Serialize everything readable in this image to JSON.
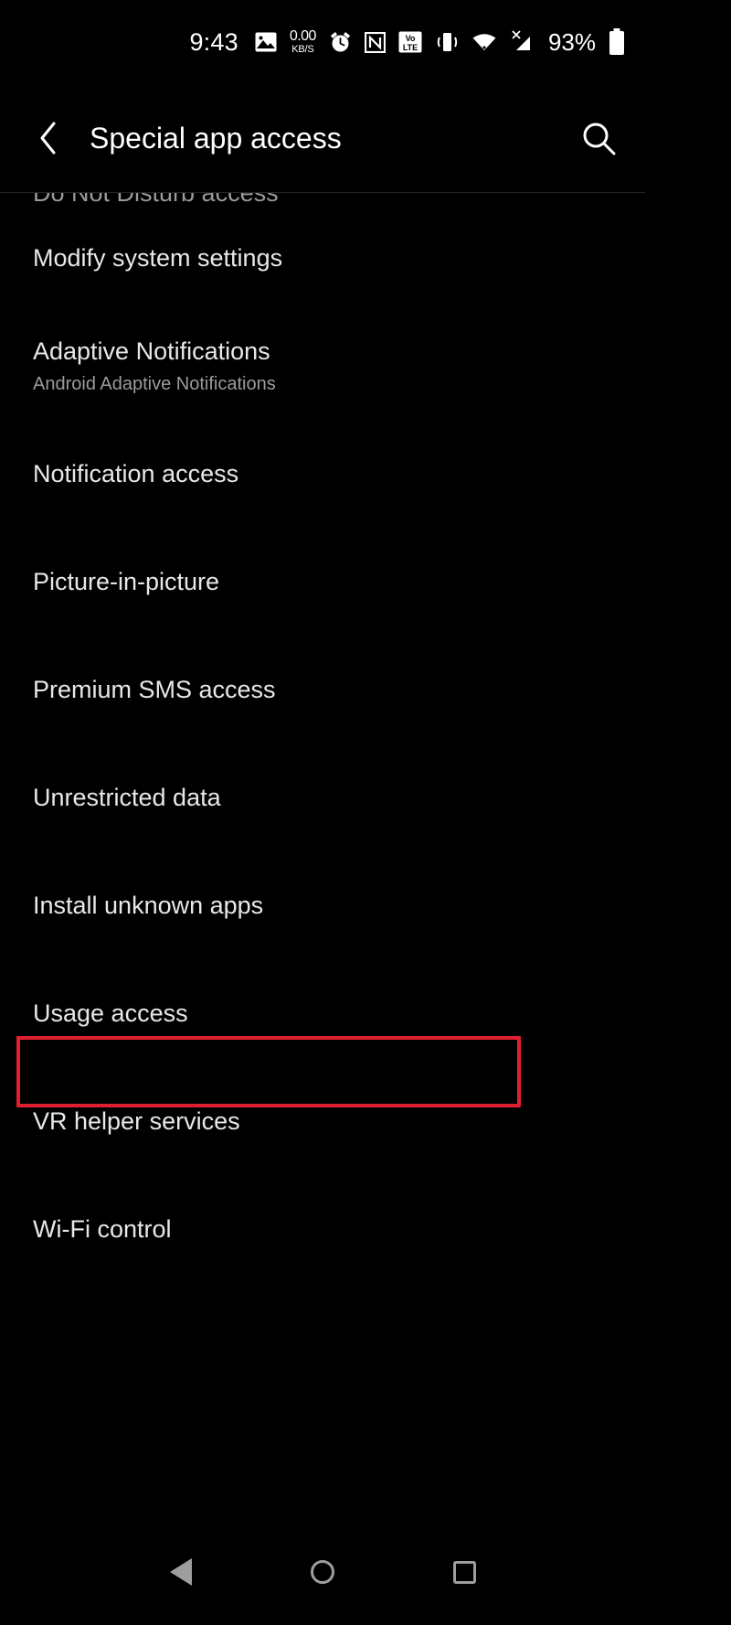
{
  "status_bar": {
    "clock": "9:43",
    "net_speed_value": "0.00",
    "net_speed_unit": "KB/S",
    "battery_percent": "93%",
    "icons": [
      "image-icon",
      "network-speed-icon",
      "alarm-icon",
      "nfc-icon",
      "volte-icon",
      "vibrate-icon",
      "wifi-icon",
      "mobile-signal-no-service-icon",
      "battery-icon"
    ]
  },
  "app_bar": {
    "back_label": "Back",
    "title": "Special app access",
    "search_label": "Search"
  },
  "list": {
    "items": [
      {
        "title": "Do Not Disturb access",
        "subtitle": "",
        "partial": true,
        "highlighted": false
      },
      {
        "title": "Modify system settings",
        "subtitle": "",
        "partial": false,
        "highlighted": false
      },
      {
        "title": "Adaptive Notifications",
        "subtitle": "Android Adaptive Notifications",
        "partial": false,
        "highlighted": false
      },
      {
        "title": "Notification access",
        "subtitle": "",
        "partial": false,
        "highlighted": false
      },
      {
        "title": "Picture-in-picture",
        "subtitle": "",
        "partial": false,
        "highlighted": false
      },
      {
        "title": "Premium SMS access",
        "subtitle": "",
        "partial": false,
        "highlighted": false
      },
      {
        "title": "Unrestricted data",
        "subtitle": "",
        "partial": false,
        "highlighted": false
      },
      {
        "title": "Install unknown apps",
        "subtitle": "",
        "partial": false,
        "highlighted": true
      },
      {
        "title": "Usage access",
        "subtitle": "",
        "partial": false,
        "highlighted": false
      },
      {
        "title": "VR helper services",
        "subtitle": "",
        "partial": false,
        "highlighted": false
      },
      {
        "title": "Wi-Fi control",
        "subtitle": "",
        "partial": false,
        "highlighted": false
      }
    ]
  },
  "nav_bar": {
    "back_label": "Back",
    "home_label": "Home",
    "recents_label": "Recents"
  },
  "colors": {
    "background": "#000000",
    "highlight_border": "#e02030",
    "primary_text": "#e8e8e8",
    "secondary_text": "#9b9b9b",
    "nav_icon": "#9e9e9e"
  }
}
